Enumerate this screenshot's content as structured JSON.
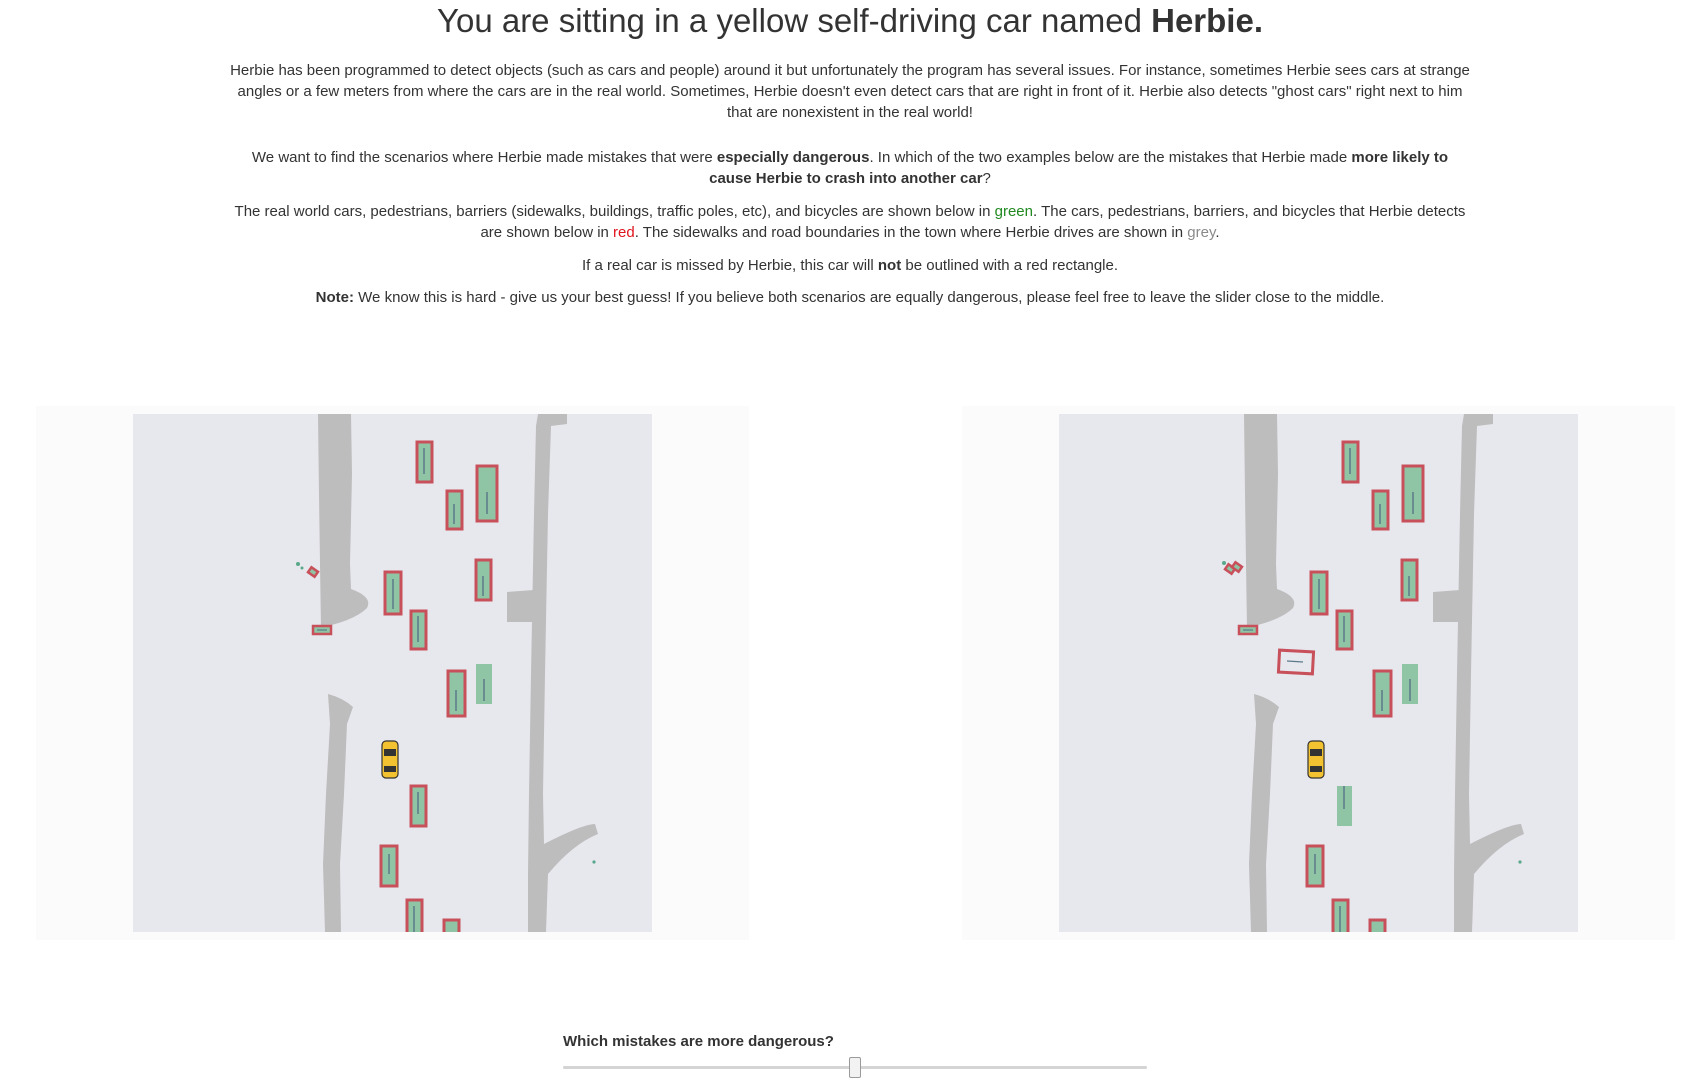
{
  "header": {
    "title_prefix": "You are sitting in a yellow self-driving car named ",
    "title_name": "Herbie."
  },
  "intro": {
    "p1": "Herbie has been programmed to detect objects (such as cars and people) around it but unfortunately the program has several issues. For instance, sometimes Herbie sees cars at strange angles or a few meters from where the cars are in the real world. Sometimes, Herbie doesn't even detect cars that are right in front of it. Herbie also detects \"ghost cars\" right next to him that are nonexistent in the real world!",
    "p2_a": "We want to find the scenarios where Herbie made mistakes that were ",
    "p2_b": "especially dangerous",
    "p2_c": ". In which of the two examples below are the mistakes that Herbie made ",
    "p2_d": "more likely to cause Herbie to crash into another car",
    "p2_e": "?",
    "p3_a": "The real world cars, pedestrians, barriers (sidewalks, buildings, traffic poles, etc), and bicycles are shown below in ",
    "p3_green": "green",
    "p3_b": ". The cars, pedestrians, barriers, and bicycles that Herbie detects are shown below in ",
    "p3_red": "red",
    "p3_c": ". The sidewalks and road boundaries in the town where Herbie drives are shown in ",
    "p3_grey": "grey",
    "p3_d": ".",
    "p4_a": "If a real car is missed by Herbie, this car will ",
    "p4_b": "not",
    "p4_c": " be outlined with a red rectangle.",
    "p5_a": "Note:",
    "p5_b": " We know this is hard - give us your best guess! If you believe both scenarios are equally dangerous, please feel free to leave the slider close to the middle."
  },
  "colors": {
    "real_object_fill": "#8fc4a4",
    "detected_outline": "#c8505a",
    "road_boundary": "#bdbdbd",
    "scene_background": "#e7e7ee",
    "ego_car": "#f2c230"
  },
  "scenarios": [
    {
      "name": "left-scenario",
      "ego_car": "yellow-car"
    },
    {
      "name": "right-scenario",
      "ego_car": "yellow-car"
    }
  ],
  "slider": {
    "label": "Which mistakes are more dangerous?",
    "value_fraction": 0.5
  }
}
